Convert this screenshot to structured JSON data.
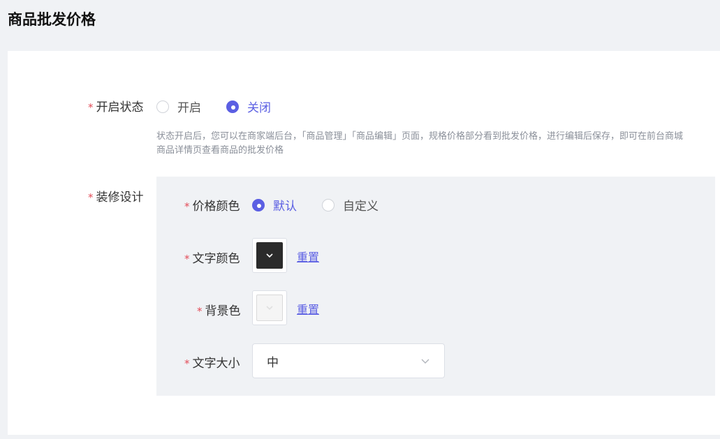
{
  "page": {
    "title": "商品批发价格"
  },
  "status": {
    "label": "开启状态",
    "options": [
      "开启",
      "关闭"
    ],
    "selected": "关闭",
    "help": "状态开启后，您可以在商家端后台，「商品管理」「商品编辑」页面，规格价格部分看到批发价格，进行编辑后保存，即可在前台商城商品详情页查看商品的批发价格"
  },
  "design": {
    "label": "装修设计",
    "price_color": {
      "label": "价格颜色",
      "options": [
        "默认",
        "自定义"
      ],
      "selected": "默认"
    },
    "text_color": {
      "label": "文字颜色",
      "value": "#2b2b2b",
      "reset_label": "重置"
    },
    "bg_color": {
      "label": "背景色",
      "value": "#f5f5f5",
      "reset_label": "重置"
    },
    "text_size": {
      "label": "文字大小",
      "value": "中"
    }
  },
  "colors": {
    "accent": "#5b5fe3",
    "required": "#e34d59"
  },
  "icons": {
    "select_arrow": "chevron-down-icon",
    "swatch_arrow": "chevron-down-icon"
  }
}
